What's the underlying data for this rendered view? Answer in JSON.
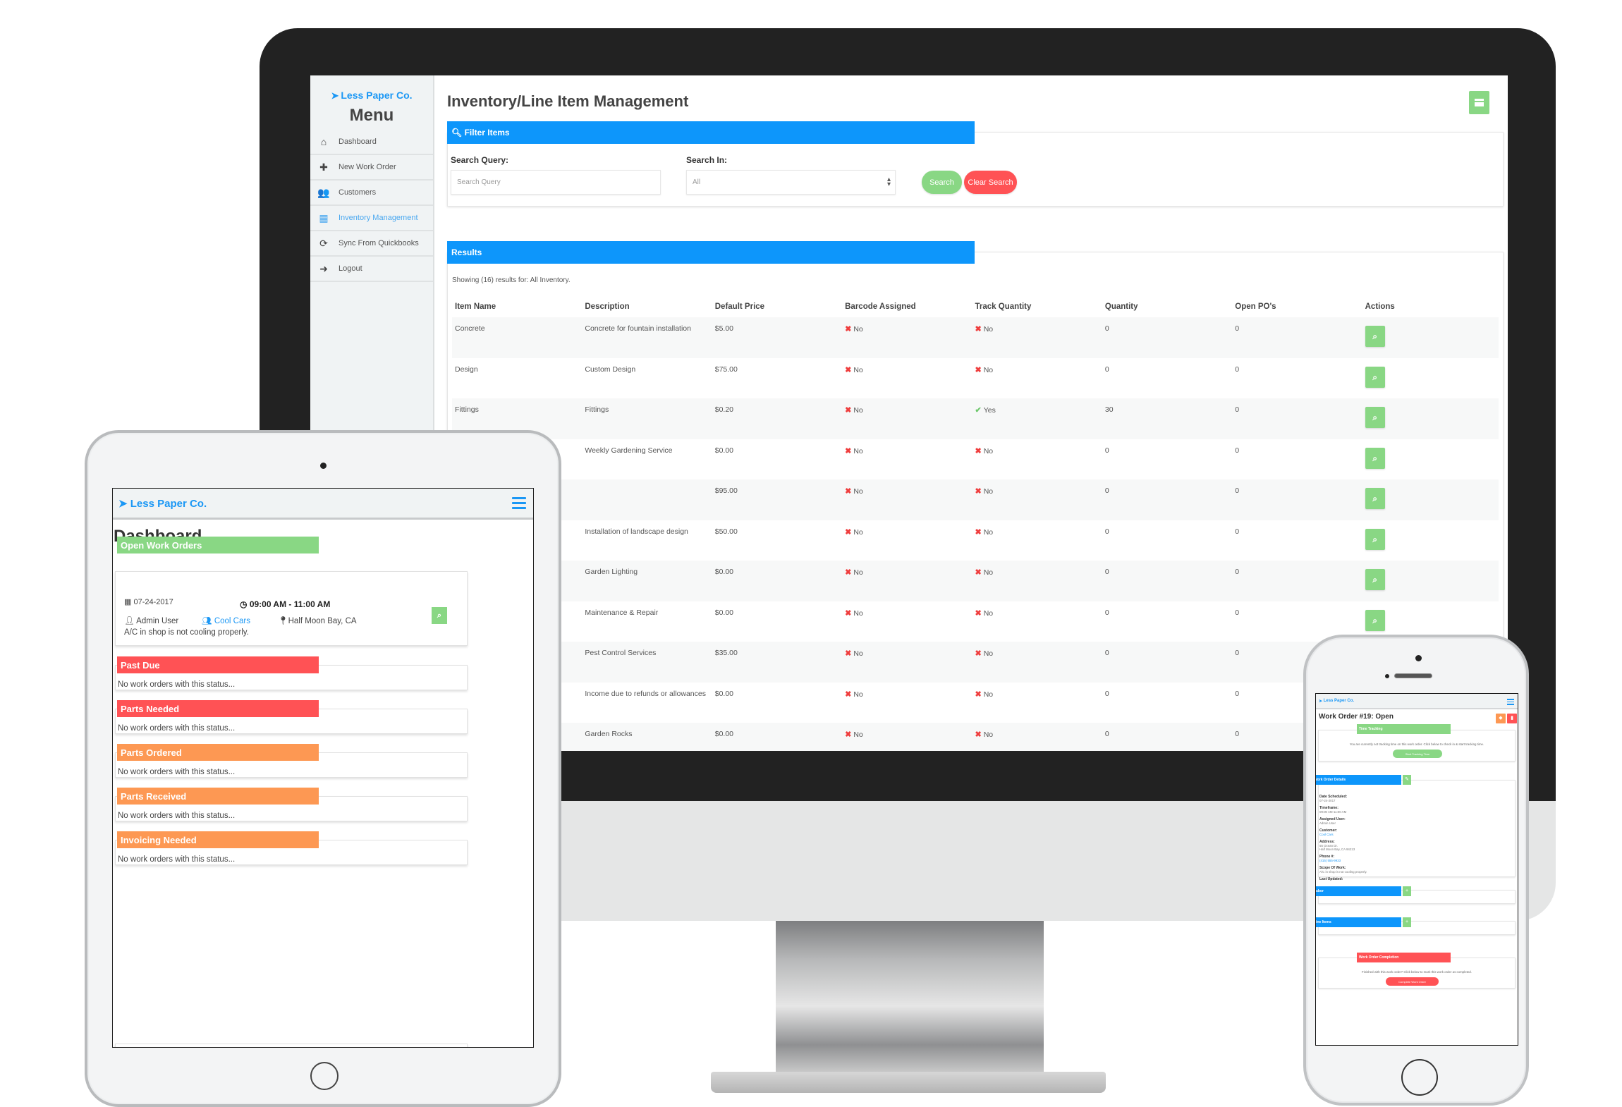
{
  "desktop": {
    "brand": "Less Paper Co.",
    "menu_title": "Menu",
    "nav": [
      {
        "label": "Dashboard",
        "icon": "home-icon",
        "glyph": "⌂",
        "active": false
      },
      {
        "label": "New Work Order",
        "icon": "plus-icon",
        "glyph": "✚",
        "active": false
      },
      {
        "label": "Customers",
        "icon": "users-icon",
        "glyph": "👥",
        "active": false
      },
      {
        "label": "Inventory Management",
        "icon": "calendar-icon",
        "glyph": "▦",
        "active": true
      },
      {
        "label": "Sync From Quickbooks",
        "icon": "refresh-icon",
        "glyph": "⟳",
        "active": false
      },
      {
        "label": "Logout",
        "icon": "logout-icon",
        "glyph": "➜",
        "active": false
      }
    ],
    "page_title": "Inventory/Line Item Management",
    "filter": {
      "heading": "Filter Items",
      "search_query_label": "Search Query:",
      "search_query_placeholder": "Search Query",
      "search_query_value": "",
      "search_in_label": "Search In:",
      "search_in_value": "All",
      "search_button": "Search",
      "clear_button": "Clear Search"
    },
    "results": {
      "heading": "Results",
      "showing_text": "Showing (16) results for: All Inventory.",
      "columns": [
        "Item Name",
        "Description",
        "Default Price",
        "Barcode Assigned",
        "Track Quantity",
        "Quantity",
        "Open PO's",
        "Actions"
      ],
      "rows": [
        {
          "name": "Concrete",
          "description": "Concrete for fountain installation",
          "price": "$5.00",
          "barcode": "No",
          "track": "No",
          "quantity": "0",
          "open_pos": "0"
        },
        {
          "name": "Design",
          "description": "Custom Design",
          "price": "$75.00",
          "barcode": "No",
          "track": "No",
          "quantity": "0",
          "open_pos": "0"
        },
        {
          "name": "Fittings",
          "description": "Fittings",
          "price": "$0.20",
          "barcode": "No",
          "track": "Yes",
          "quantity": "30",
          "open_pos": "0"
        },
        {
          "name": "",
          "description": "Weekly Gardening Service",
          "price": "$0.00",
          "barcode": "No",
          "track": "No",
          "quantity": "0",
          "open_pos": "0"
        },
        {
          "name": "",
          "description": "",
          "price": "$95.00",
          "barcode": "No",
          "track": "No",
          "quantity": "0",
          "open_pos": "0"
        },
        {
          "name": "",
          "description": "Installation of landscape design",
          "price": "$50.00",
          "barcode": "No",
          "track": "No",
          "quantity": "0",
          "open_pos": "0"
        },
        {
          "name": "",
          "description": "Garden Lighting",
          "price": "$0.00",
          "barcode": "No",
          "track": "No",
          "quantity": "0",
          "open_pos": "0"
        },
        {
          "name": "",
          "description": "Maintenance & Repair",
          "price": "$0.00",
          "barcode": "No",
          "track": "No",
          "quantity": "0",
          "open_pos": "0"
        },
        {
          "name": "",
          "description": "Pest Control Services",
          "price": "$35.00",
          "barcode": "No",
          "track": "No",
          "quantity": "0",
          "open_pos": "0"
        },
        {
          "name": "",
          "description": "Income due to refunds or allowances",
          "price": "$0.00",
          "barcode": "No",
          "track": "No",
          "quantity": "0",
          "open_pos": "0"
        },
        {
          "name": "",
          "description": "Garden Rocks",
          "price": "$0.00",
          "barcode": "No",
          "track": "No",
          "quantity": "0",
          "open_pos": "0"
        }
      ]
    }
  },
  "tablet": {
    "brand": "Less Paper Co.",
    "title": "Dashboard",
    "open_orders": {
      "heading": "Open Work Orders",
      "date": "07-24-2017",
      "time": "09:00 AM - 11:00 AM",
      "user": "Admin User",
      "customer": "Cool Cars",
      "location": "Half Moon Bay, CA",
      "description": "A/C in shop is not cooling properly."
    },
    "statuses": [
      {
        "heading": "Past Due",
        "color": "#ff5255",
        "empty_text": "No work orders with this status..."
      },
      {
        "heading": "Parts Needed",
        "color": "#ff5255",
        "empty_text": "No work orders with this status..."
      },
      {
        "heading": "Parts Ordered",
        "color": "#fd9853",
        "empty_text": "No work orders with this status..."
      },
      {
        "heading": "Parts Received",
        "color": "#fd9853",
        "empty_text": "No work orders with this status..."
      },
      {
        "heading": "Invoicing Needed",
        "color": "#fd9853",
        "empty_text": "No work orders with this status..."
      }
    ]
  },
  "phone": {
    "brand": "Less Paper Co.",
    "title": "Work Order #19: Open",
    "time_tracking": {
      "heading": "Time Tracking",
      "text": "You are currently not tracking time on this work order. Click below to check in & start tracking time.",
      "button": "Start Tracking Time"
    },
    "details": {
      "heading": "Work Order Details",
      "fields": [
        {
          "label": "Date Scheduled:",
          "value": "07-24-2017",
          "link": false
        },
        {
          "label": "Timeframe:",
          "value": "09:00 AM-11:00 AM",
          "link": false
        },
        {
          "label": "Assigned User:",
          "value": "Admin User",
          "link": false
        },
        {
          "label": "Customer:",
          "value": "Cool Cars",
          "link": true
        },
        {
          "label": "Address:",
          "value": "55 Ocean Dr.",
          "value2": "Half Moon Bay, CA 94213",
          "link": false
        },
        {
          "label": "Phone #:",
          "value": "(415) 555-9933",
          "link": true
        },
        {
          "label": "Scope Of Work:",
          "value": "A/C in shop is not cooling properly.",
          "link": false
        },
        {
          "label": "Last Updated:",
          "value": "",
          "link": false
        }
      ]
    },
    "labor_heading": "Labor",
    "line_items_heading": "Line Items",
    "completion": {
      "heading": "Work Order Completion",
      "text": "Finished with this work order? Click below to mark this work order as completed.",
      "button": "Complete Work Order"
    }
  },
  "colors": {
    "brand_blue": "#1a97f5",
    "header_blue": "#0d96fb",
    "success_green": "#89d784",
    "danger_red": "#ff5255",
    "warning_orange": "#fd9853"
  }
}
